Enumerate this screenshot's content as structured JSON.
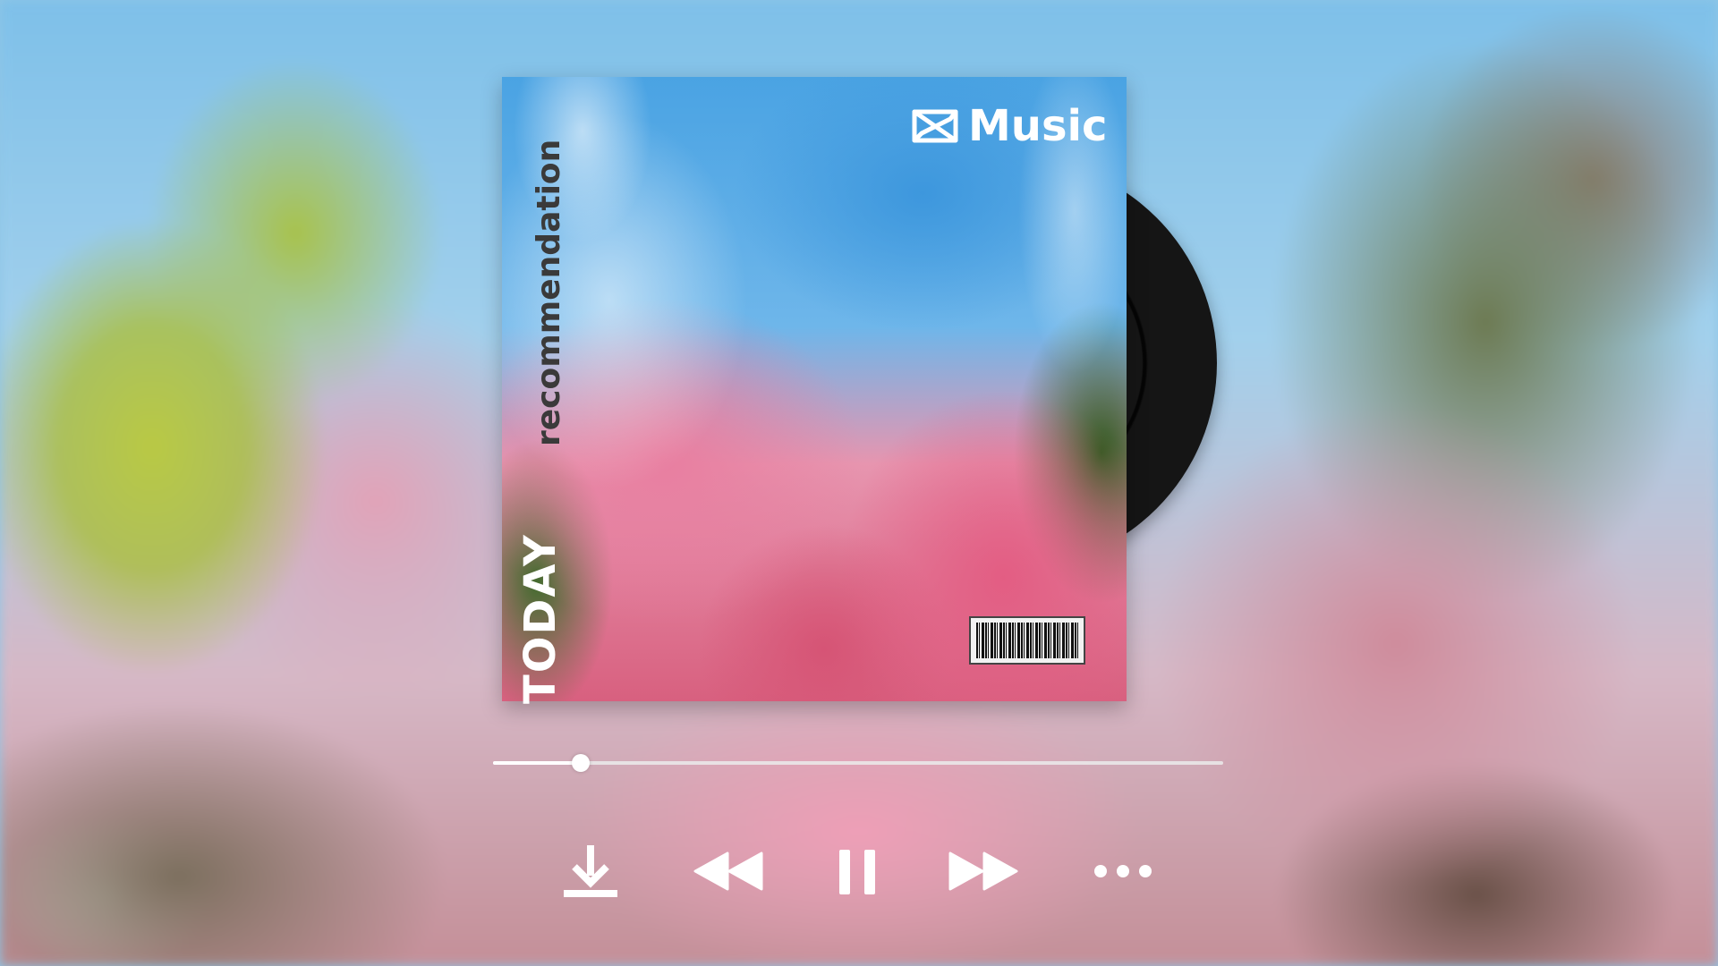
{
  "album": {
    "brand_label": "Music",
    "brand_icon": "capcut-logo-icon",
    "vertical_today": "TODAY",
    "vertical_recommendation": "recommendation",
    "barcode_icon": "barcode-icon"
  },
  "player": {
    "progress": 0.12,
    "controls": {
      "download_icon": "download-icon",
      "rewind_icon": "rewind-icon",
      "pause_icon": "pause-icon",
      "forward_icon": "fast-forward-icon",
      "more_icon": "more-options-icon"
    }
  },
  "colors": {
    "accent": "#ffffff",
    "sky": "#7ec0e9",
    "blossom": "#e35d83",
    "vinyl": "#111111"
  }
}
